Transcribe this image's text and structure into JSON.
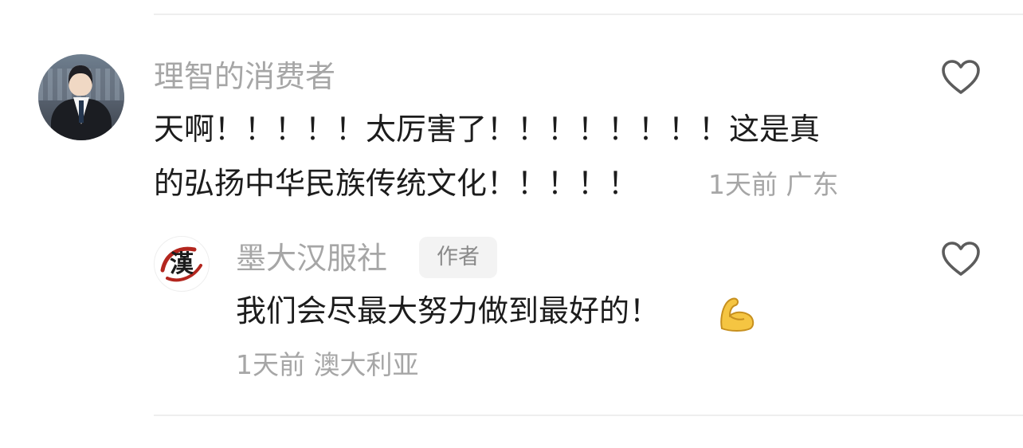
{
  "top_comment": {
    "username": "理智的消费者",
    "text_line1": "天啊！！！！！太厉害了！！！！！！！！这是真",
    "text_line2": "的弘扬中华民族传统文化！！！！！",
    "meta": "1天前 广东",
    "avatar": "user-photo-avatar",
    "like_icon": "heart-outline-icon"
  },
  "reply": {
    "username": "墨大汉服社",
    "badge": "作者",
    "text": "我们会尽最大努力做到最好的！",
    "emoji": "flexed-biceps-emoji",
    "meta": "1天前 澳大利亚",
    "avatar": "han-calligraphy-logo",
    "avatar_logo_text": "漢",
    "like_icon": "heart-outline-icon"
  },
  "colors": {
    "username": "#a6a6a6",
    "body_text": "#1c1c1c",
    "meta_text": "#a6a6a6",
    "badge_bg": "#f3f3f3",
    "divider": "#eeeeee",
    "logo_red": "#b3261e"
  }
}
